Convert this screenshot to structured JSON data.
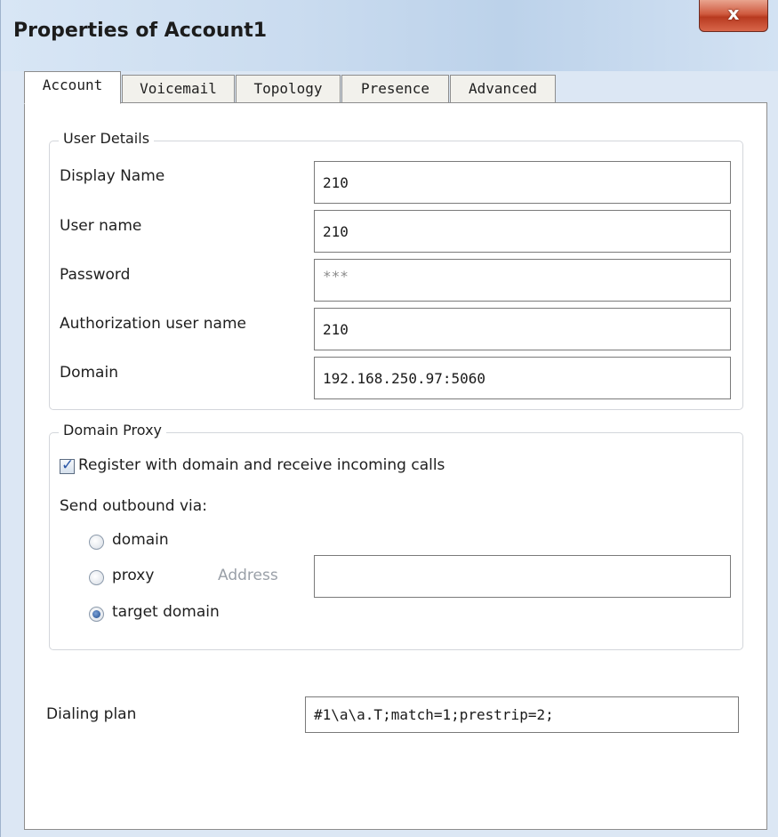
{
  "window": {
    "title": "Properties of Account1",
    "close_symbol": "x"
  },
  "tabs": [
    "Account",
    "Voicemail",
    "Topology",
    "Presence",
    "Advanced"
  ],
  "active_tab": "Account",
  "user_details": {
    "legend": "User Details",
    "display_name": {
      "label": "Display Name",
      "value": "210"
    },
    "user_name": {
      "label": "User name",
      "value": "210"
    },
    "password": {
      "label": "Password",
      "value": "***"
    },
    "auth_user_name": {
      "label": "Authorization user name",
      "value": "210"
    },
    "domain": {
      "label": "Domain",
      "value": "192.168.250.97:5060"
    }
  },
  "domain_proxy": {
    "legend": "Domain Proxy",
    "register_label": "Register with domain and receive incoming calls",
    "register_checked": true,
    "send_outbound_label": "Send outbound via:",
    "options": [
      "domain",
      "proxy",
      "target domain"
    ],
    "selected_option": "target domain",
    "address_label": "Address",
    "address_value": ""
  },
  "dialing_plan": {
    "label": "Dialing plan",
    "value": "#1\\a\\a.T;match=1;prestrip=2;"
  },
  "colors": {
    "window_chrome": "#dce7f4",
    "close_button": "#c8452c",
    "radio_selected": "#1d4a8c"
  }
}
